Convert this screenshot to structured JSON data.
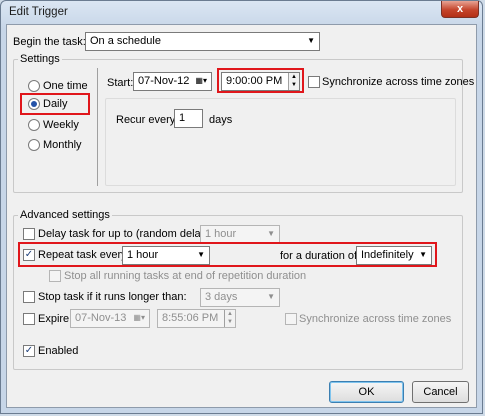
{
  "window": {
    "title": "Edit Trigger",
    "close_glyph": "x"
  },
  "begin_task": {
    "label": "Begin the task:",
    "value": "On a schedule"
  },
  "settings": {
    "title": "Settings",
    "radios": [
      {
        "label": "One time",
        "selected": false
      },
      {
        "label": "Daily",
        "selected": true
      },
      {
        "label": "Weekly",
        "selected": false
      },
      {
        "label": "Monthly",
        "selected": false
      }
    ],
    "start_label": "Start:",
    "start_date": "07-Nov-12",
    "start_time": "9:00:00 PM",
    "sync_label": "Synchronize across time zones",
    "recur_label": "Recur every:",
    "recur_value": "1",
    "recur_unit": "days"
  },
  "advanced": {
    "title": "Advanced settings",
    "delay_label": "Delay task for up to (random delay):",
    "delay_value": "1 hour",
    "repeat_label": "Repeat task every:",
    "repeat_value": "1 hour",
    "duration_label": "for a duration of:",
    "duration_value": "Indefinitely",
    "stop_running_label": "Stop all running tasks at end of repetition duration",
    "stop_longer_label": "Stop task if it runs longer than:",
    "stop_longer_value": "3 days",
    "expire_label": "Expire:",
    "expire_date": "07-Nov-13",
    "expire_time": "8:55:06 PM",
    "expire_sync_label": "Synchronize across time zones",
    "enabled_label": "Enabled"
  },
  "buttons": {
    "ok": "OK",
    "cancel": "Cancel"
  },
  "colors": {
    "highlight": "#e0161b",
    "accent": "#2453a8"
  }
}
